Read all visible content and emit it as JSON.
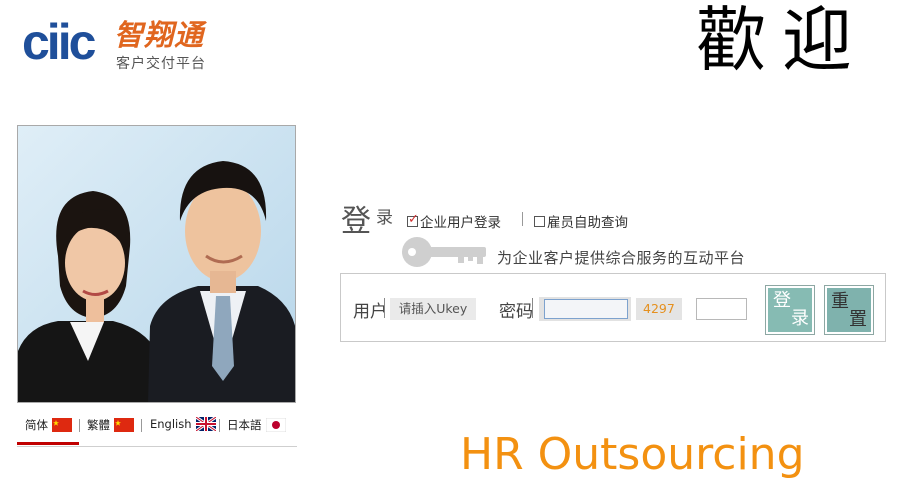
{
  "logo": {
    "mark": "ciic",
    "name_cn": "智翔通",
    "subtitle": "客户交付平台"
  },
  "welcome": "歡迎",
  "languages": [
    {
      "label": "简体",
      "flag": "china-flag-icon"
    },
    {
      "label": "繁體",
      "flag": "china-flag-icon"
    },
    {
      "label": "English",
      "flag": "uk-flag-icon"
    },
    {
      "label": "日本語",
      "flag": "japan-flag-icon"
    }
  ],
  "login": {
    "title_big": "登",
    "title_small": "录",
    "options": [
      {
        "label": "企业用户登录",
        "checked": true
      },
      {
        "label": "雇员自助查询",
        "checked": false
      }
    ],
    "tagline": "为企业客户提供综合服务的互动平台",
    "user_label": "用户",
    "ukey_placeholder": "请插入Ukey",
    "password_label": "密码",
    "captcha_code": "4297",
    "login_button": [
      "登",
      "录"
    ],
    "reset_button": [
      "重",
      "置"
    ]
  },
  "footer_slogan": "HR Outsourcing",
  "colors": {
    "brand_blue": "#1f4f9a",
    "brand_orange": "#f39111",
    "button_teal": "#86bbb3",
    "accent_red": "#c00000"
  }
}
